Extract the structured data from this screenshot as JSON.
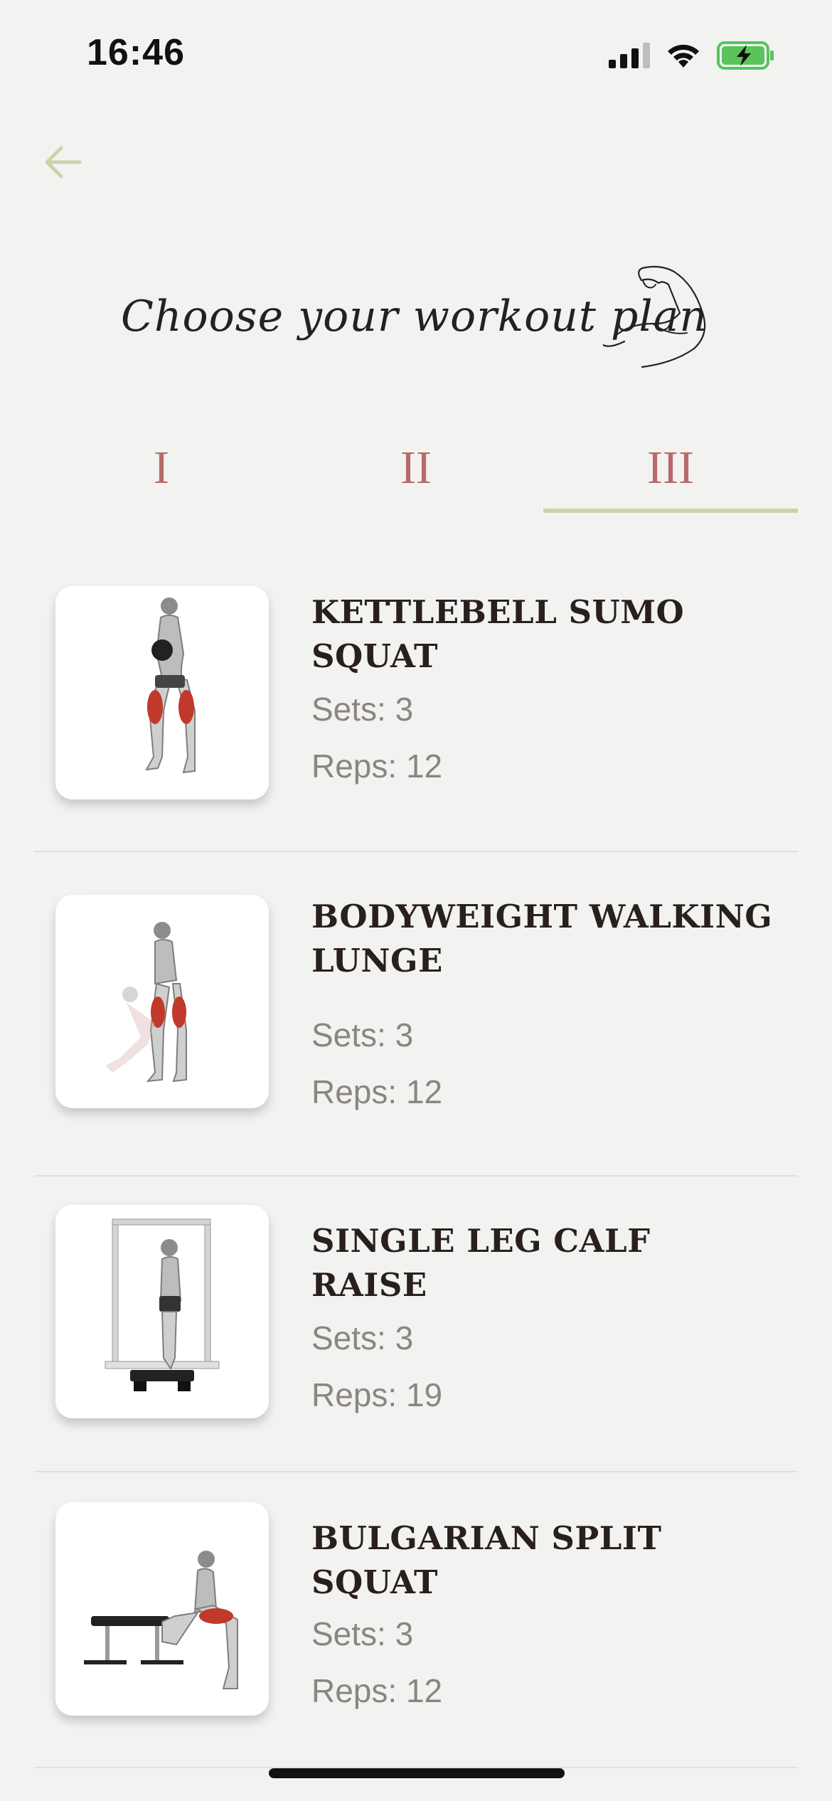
{
  "status_bar": {
    "time": "16:46",
    "battery_color": "#5ac35a"
  },
  "nav": {
    "back_icon": "arrow-left-icon",
    "accent_color": "#c9d4a8"
  },
  "header": {
    "title": "Choose your workout plan",
    "icon": "flexed-bicep-icon"
  },
  "tabs": [
    {
      "label": "I",
      "selected": false
    },
    {
      "label": "II",
      "selected": false
    },
    {
      "label": "III",
      "selected": true
    }
  ],
  "exercises": [
    {
      "name": "KETTLEBELL SUMO SQUAT",
      "sets_label": "Sets: 3",
      "reps_label": "Reps: 12",
      "image": "kettlebell-sumo-squat-illustration"
    },
    {
      "name": "BODYWEIGHT WALKING LUNGE",
      "sets_label": "Sets: 3",
      "reps_label": "Reps: 12",
      "image": "walking-lunge-illustration"
    },
    {
      "name": "SINGLE LEG CALF RAISE",
      "sets_label": "Sets: 3",
      "reps_label": "Reps: 19",
      "image": "calf-raise-illustration"
    },
    {
      "name": "BULGARIAN SPLIT SQUAT",
      "sets_label": "Sets: 3",
      "reps_label": "Reps: 12",
      "image": "bulgarian-split-squat-illustration"
    }
  ]
}
